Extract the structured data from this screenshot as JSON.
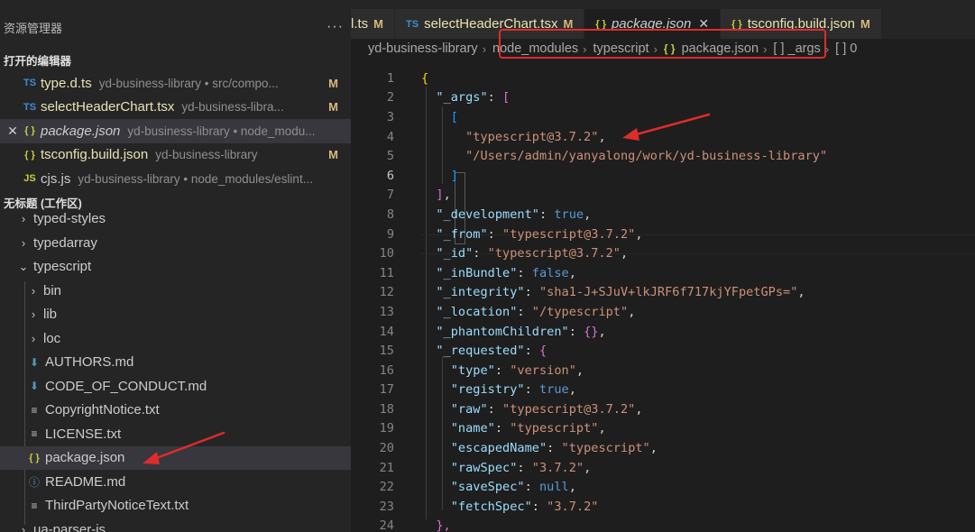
{
  "sidebar": {
    "title": "资源管理器",
    "more": "···",
    "open_editors": {
      "title": "打开的编辑器",
      "items": [
        {
          "icon": "TS",
          "name": "type.d.ts",
          "desc": "yd-business-library • src/compo...",
          "mark": "M"
        },
        {
          "icon": "TS",
          "name": "selectHeaderChart.tsx",
          "desc": "yd-business-libra...",
          "mark": "M"
        },
        {
          "icon": "{ }",
          "name": "package.json",
          "desc": "yd-business-library • node_modu...",
          "mark": ""
        },
        {
          "icon": "{ }",
          "name": "tsconfig.build.json",
          "desc": "yd-business-library",
          "mark": "M"
        },
        {
          "icon": "JS",
          "name": "cjs.js",
          "desc": "yd-business-library • node_modules/eslint...",
          "mark": ""
        }
      ],
      "close_glyph": "✕"
    },
    "workspace": {
      "title": "无标题 (工作区)",
      "items": [
        {
          "name": "typed-styles",
          "chev": "›"
        },
        {
          "name": "typedarray",
          "chev": "›"
        },
        {
          "name": "typescript",
          "chev": "⌄"
        },
        {
          "name": "bin",
          "chev": "›"
        },
        {
          "name": "lib",
          "chev": "›"
        },
        {
          "name": "loc",
          "chev": "›"
        },
        {
          "name": "AUTHORS.md",
          "icon": "⬇"
        },
        {
          "name": "CODE_OF_CONDUCT.md",
          "icon": "⬇"
        },
        {
          "name": "CopyrightNotice.txt",
          "icon": "≡"
        },
        {
          "name": "LICENSE.txt",
          "icon": "≡"
        },
        {
          "name": "package.json",
          "icon": "{ }"
        },
        {
          "name": "README.md",
          "icon": "ⓘ"
        },
        {
          "name": "ThirdPartyNoticeText.txt",
          "icon": "≡"
        },
        {
          "name": "ua-parser-js",
          "chev": "›"
        }
      ]
    }
  },
  "tabs": [
    {
      "icon": "",
      "label": "l.ts",
      "mark": "M"
    },
    {
      "icon": "TS",
      "label": "selectHeaderChart.tsx",
      "mark": "M"
    },
    {
      "icon": "{ }",
      "label": "package.json",
      "close": "✕"
    },
    {
      "icon": "{ }",
      "label": "tsconfig.build.json",
      "mark": "M"
    }
  ],
  "breadcrumb": {
    "root": "yd-business-library",
    "seg1": "node_modules",
    "seg2": "typescript",
    "file_icon": "{ }",
    "file": "package.json",
    "sym1": "[ ] _args",
    "sym2": "[ ] 0",
    "sep": "›"
  },
  "code": {
    "line_numbers": [
      "1",
      "2",
      "3",
      "4",
      "5",
      "6",
      "7",
      "8",
      "9",
      "10",
      "11",
      "12",
      "13",
      "14",
      "15",
      "16",
      "17",
      "18",
      "19",
      "20",
      "21",
      "22",
      "23",
      "24"
    ],
    "l1": "{",
    "l2_key": "\"_args\"",
    "l2_rest": ": [",
    "l3": "[",
    "l4": "\"typescript@3.7.2\"",
    "l5": "\"/Users/admin/yanyalong/work/yd-business-library\"",
    "l6": "]",
    "l7": "],",
    "l8_key": "\"_development\"",
    "l8_val": "true",
    "l9_key": "\"_from\"",
    "l9_val": "\"typescript@3.7.2\"",
    "l10_key": "\"_id\"",
    "l10_val": "\"typescript@3.7.2\"",
    "l11_key": "\"_inBundle\"",
    "l11_val": "false",
    "l12_key": "\"_integrity\"",
    "l12_val": "\"sha1-J+SJuV+lkJRF6f717kjYFpetGPs=\"",
    "l13_key": "\"_location\"",
    "l13_val": "\"/typescript\"",
    "l14_key": "\"_phantomChildren\"",
    "l14_val": "{}",
    "l15_key": "\"_requested\"",
    "l15_val": "{",
    "l16_key": "\"type\"",
    "l16_val": "\"version\"",
    "l17_key": "\"registry\"",
    "l17_val": "true",
    "l18_key": "\"raw\"",
    "l18_val": "\"typescript@3.7.2\"",
    "l19_key": "\"name\"",
    "l19_val": "\"typescript\"",
    "l20_key": "\"escapedName\"",
    "l20_val": "\"typescript\"",
    "l21_key": "\"rawSpec\"",
    "l21_val": "\"3.7.2\"",
    "l22_key": "\"saveSpec\"",
    "l22_val": "null",
    "l23_key": "\"fetchSpec\"",
    "l23_val": "\"3.7.2\"",
    "l24": "},"
  },
  "colors": {
    "annotation": "#e02b2b",
    "sidebar_bg": "#252526",
    "editor_bg": "#1e1e1e"
  }
}
